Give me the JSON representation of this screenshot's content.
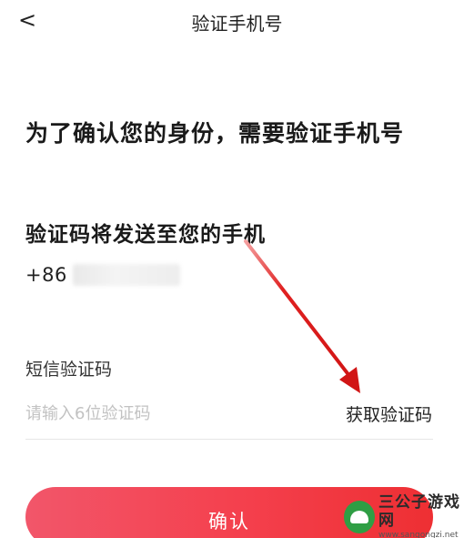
{
  "nav": {
    "back_icon": "chevron-left-icon",
    "back_glyph": "<",
    "title": "验证手机号"
  },
  "main": {
    "headline": "为了确认您的身份，需要验证手机号",
    "subhead": "验证码将发送至您的手机",
    "phone_prefix": "+86",
    "sms_label": "短信验证码",
    "code_input": {
      "placeholder": "请输入6位验证码",
      "value": ""
    },
    "get_code_label": "获取验证码",
    "confirm_label": "确认"
  },
  "annotation": {
    "arrow_color": "#e02020"
  },
  "watermark": {
    "name": "三公子游戏网",
    "url": "www.sangongzi.net"
  },
  "colors": {
    "accent_start": "#f2566a",
    "accent_end": "#ee2f33",
    "placeholder": "#c2c2c2"
  }
}
